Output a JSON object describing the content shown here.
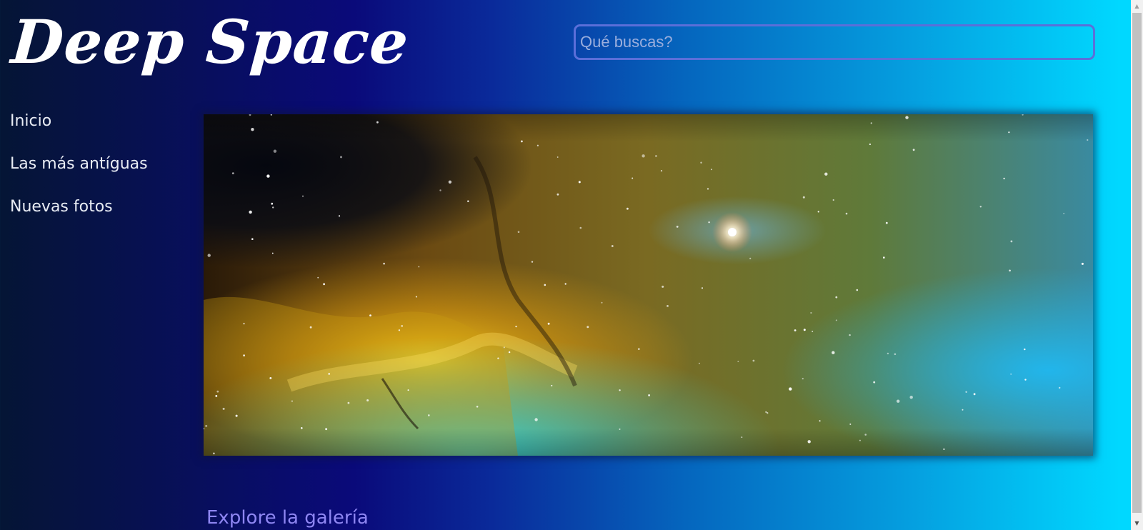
{
  "header": {
    "logo_text": "Deep Space",
    "search_placeholder": "Qué buscas?",
    "search_value": ""
  },
  "nav": {
    "items": [
      {
        "label": "Inicio"
      },
      {
        "label": "Las más antíguas"
      },
      {
        "label": "Nuevas fotos"
      }
    ]
  },
  "hero": {
    "image_subject": "nebula-photo"
  },
  "main": {
    "explore_link": "Explore la galería"
  },
  "colors": {
    "text_light": "#ffffff",
    "nav_text": "#e8ecf4",
    "link": "#8e86f2",
    "search_border": "#5b6fd9",
    "gradient_left": "#051535",
    "gradient_mid": "#0a0a7a",
    "gradient_right": "#00d8ff"
  },
  "icons": {
    "scroll_up": "arrow-up-icon",
    "scroll_down": "arrow-down-icon"
  }
}
